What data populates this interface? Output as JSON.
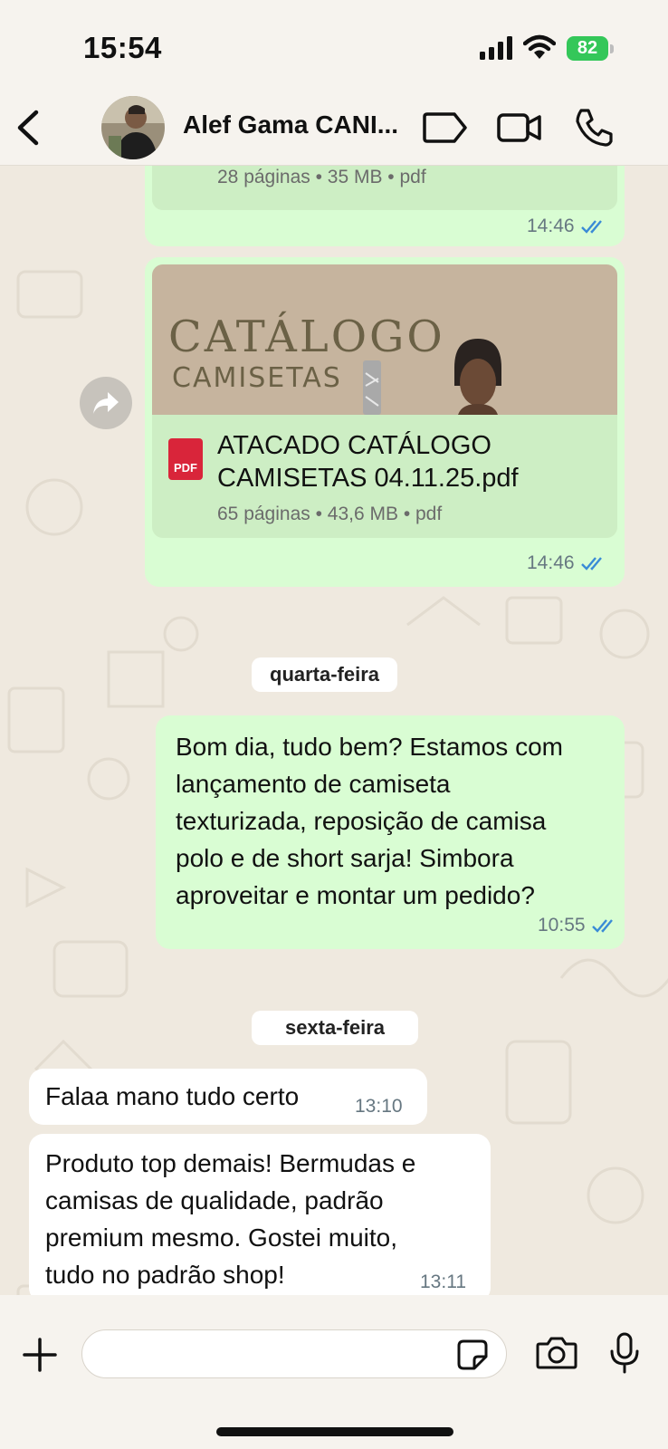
{
  "status_bar": {
    "time": "15:54",
    "battery": "82",
    "signal-icon": "cellular-signal",
    "wifi-icon": "wifi"
  },
  "header": {
    "contact_name": "Alef Gama CANI...",
    "icons": [
      "chevron-left-icon",
      "label-tag-icon",
      "video-camera-icon",
      "phone-icon"
    ]
  },
  "messages": {
    "doc1": {
      "meta": "28 páginas • 35 MB • pdf",
      "time": "14:46"
    },
    "doc2": {
      "preview_title": "CATÁLOGO",
      "preview_subtitle": "CAMISETAS",
      "badge": "PDF",
      "filename_line1": "ATACADO CATÁLOGO",
      "filename_line2": "CAMISETAS 04.11.25.pdf",
      "meta": "65 páginas • 43,6 MB • pdf",
      "time": "14:46"
    },
    "day1": "quarta-feira",
    "out_text": {
      "lines": [
        "Bom dia, tudo bem? Estamos com",
        "lançamento de camiseta",
        "texturizada, reposição de camisa",
        "polo e de short sarja! Simbora",
        "aproveitar e montar um pedido?"
      ],
      "time": "10:55"
    },
    "day2": "sexta-feira",
    "in1": {
      "text": "Falaa mano tudo certo",
      "time": "13:10"
    },
    "in2": {
      "lines": [
        "Produto top demais! Bermudas e",
        "camisas de qualidade, padrão",
        "premium mesmo. Gostei muito,",
        "tudo no padrão shop!"
      ],
      "time": "13:11"
    }
  },
  "input_bar": {
    "placeholder": "",
    "icons": [
      "plus-icon",
      "sticker-icon",
      "camera-icon",
      "microphone-icon"
    ]
  },
  "colors": {
    "outgoing_bubble": "#d9fdd3",
    "incoming_bubble": "#ffffff",
    "read_ticks": "#3a8bd6",
    "battery": "#34c759"
  }
}
